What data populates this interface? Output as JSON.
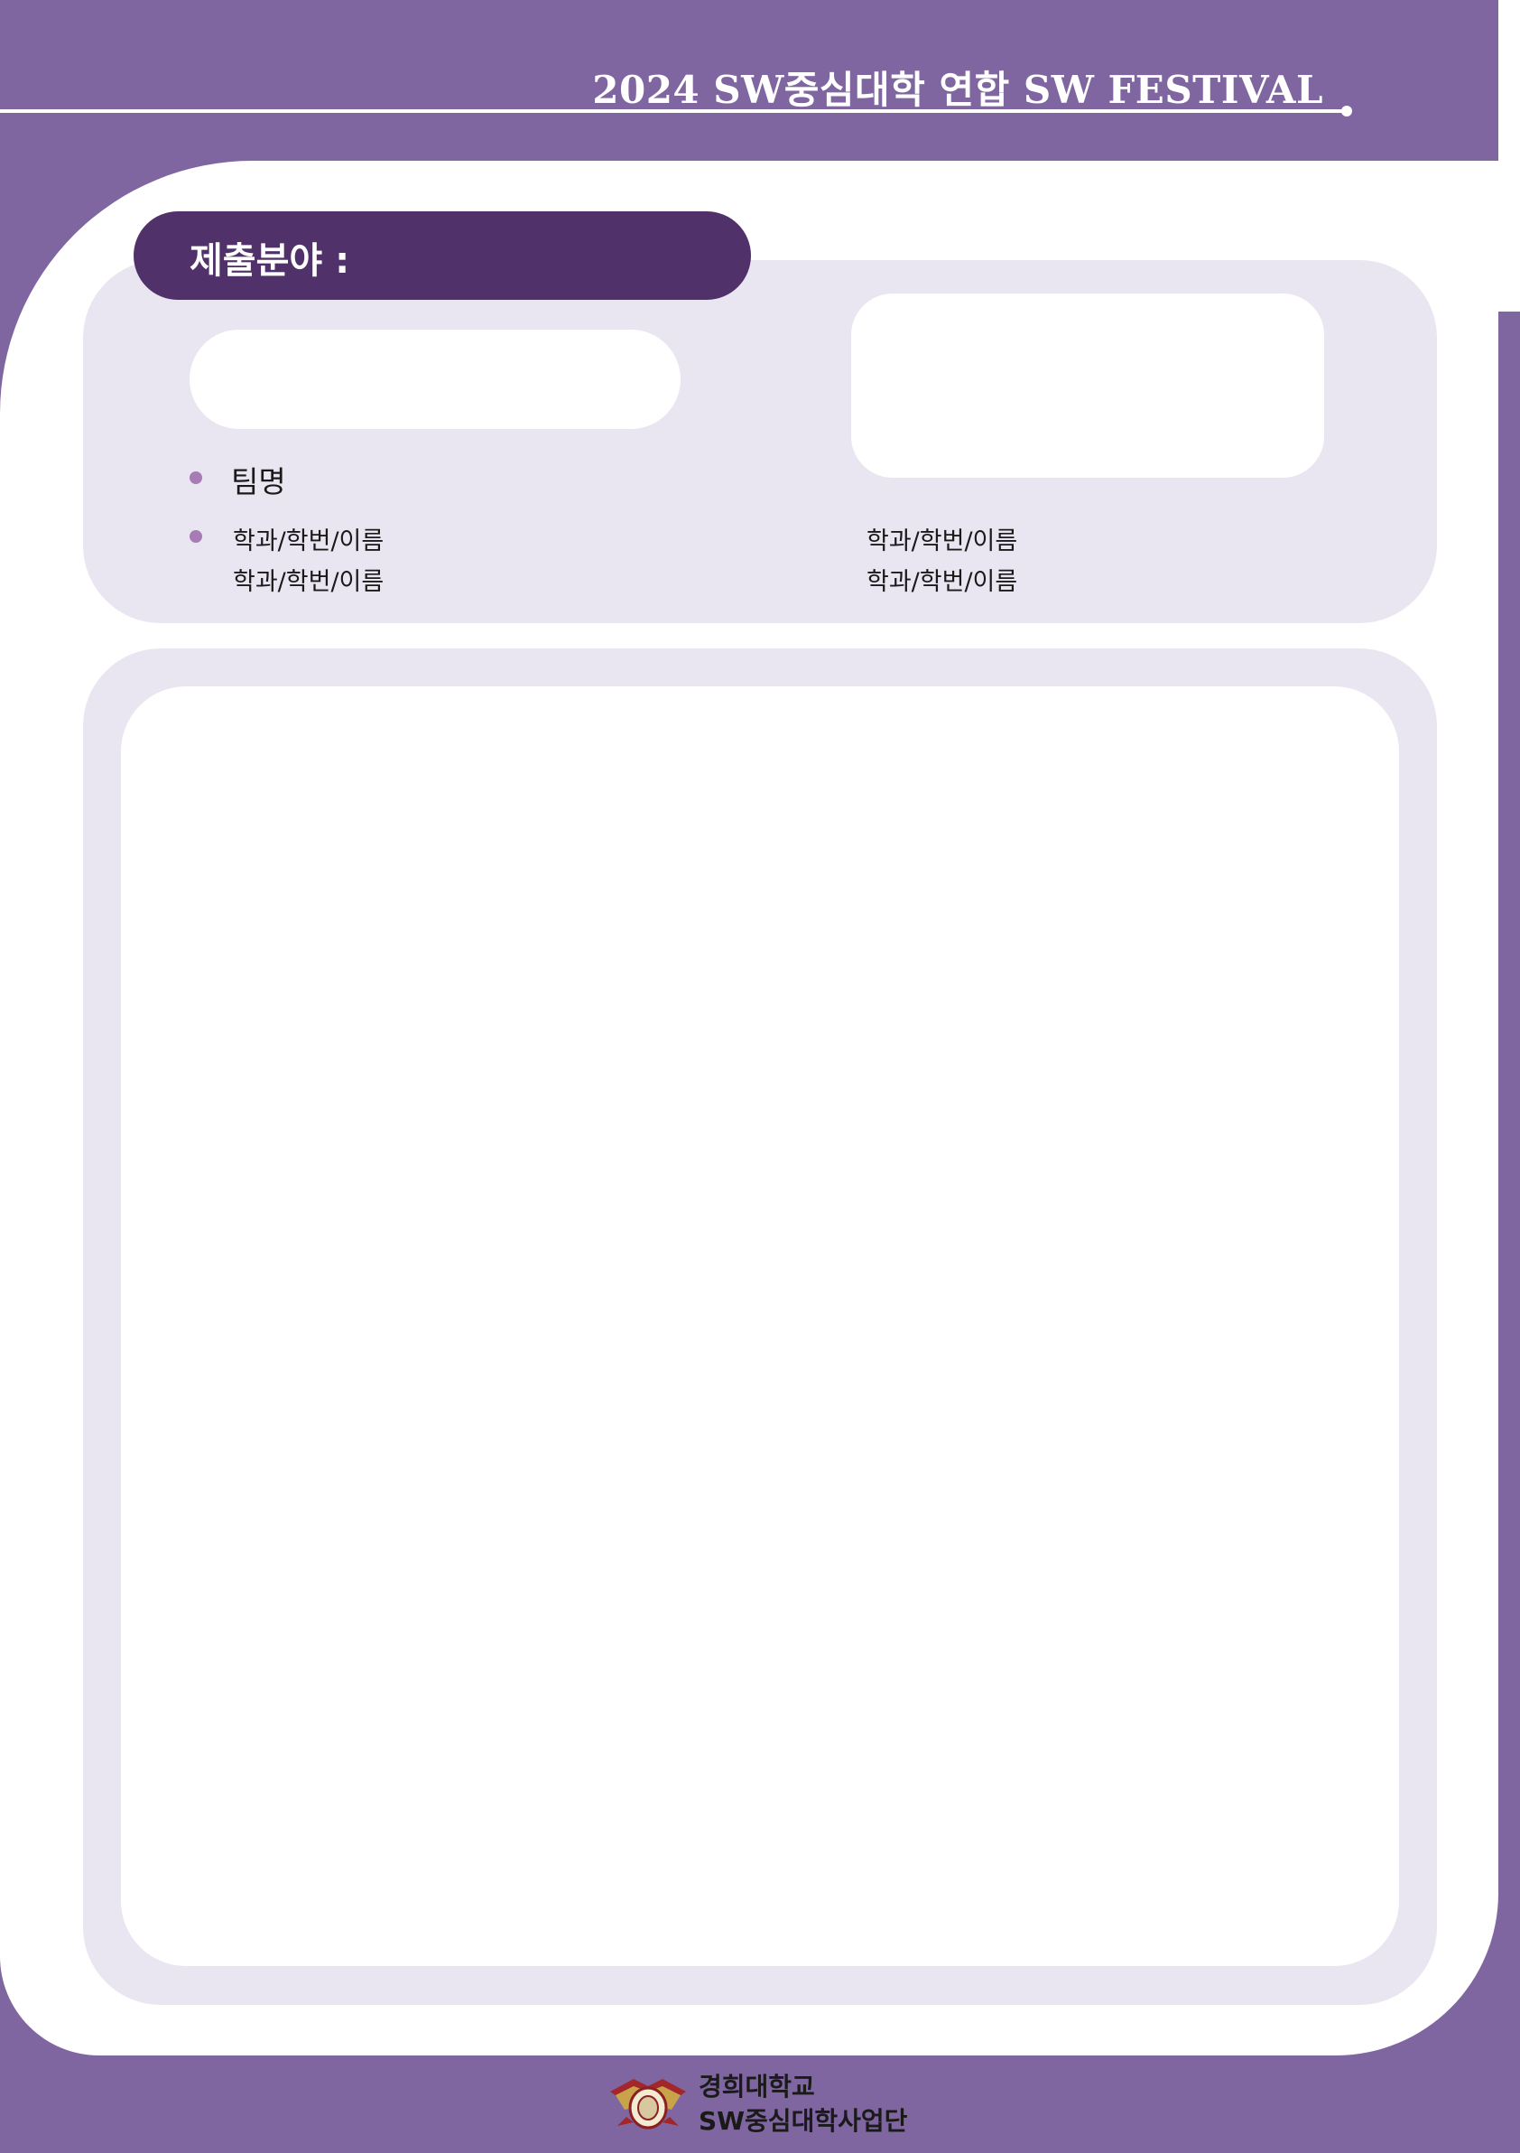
{
  "header": {
    "title": "2024 SW중심대학 연합 SW FESTIVAL"
  },
  "submission": {
    "category_label": "제출분야 :"
  },
  "team": {
    "label": "팀명",
    "members": [
      "학과/학번/이름",
      "학과/학번/이름",
      "학과/학번/이름",
      "학과/학번/이름"
    ]
  },
  "footer": {
    "line1": "경희대학교",
    "line2": "SW중심대학사업단",
    "logo_icon": "university-emblem-icon"
  },
  "colors": {
    "frame": "#7f66a0",
    "pill": "#503169",
    "panel": "#e9e6f1",
    "bullet": "#a77bb4"
  }
}
